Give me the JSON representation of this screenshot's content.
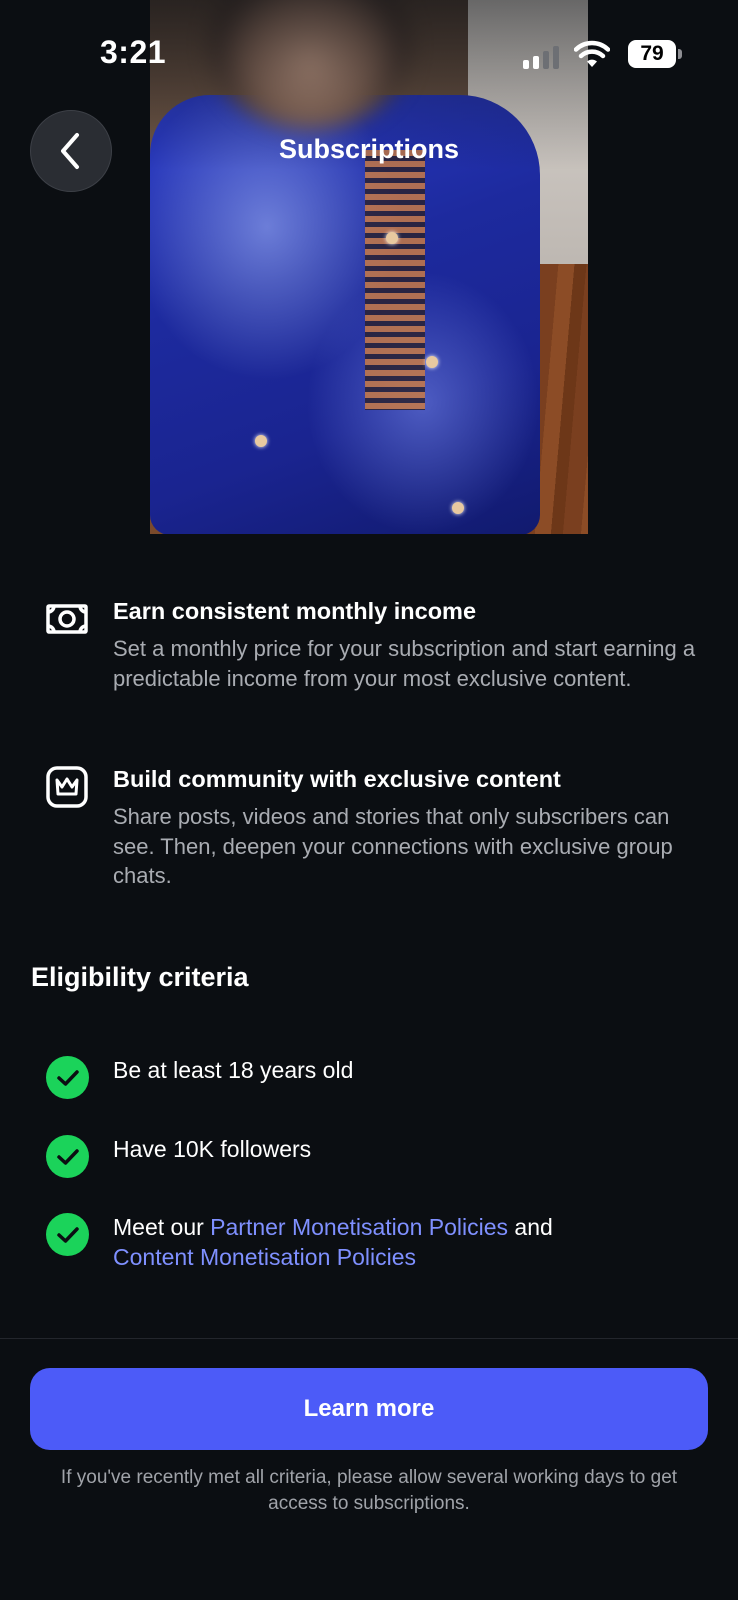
{
  "status_bar": {
    "time": "3:21",
    "battery": "79",
    "icons": [
      "cellular-signal-icon",
      "wifi-icon",
      "battery-icon"
    ]
  },
  "header": {
    "title": "Subscriptions",
    "back_icon": "chevron-left-icon"
  },
  "features": [
    {
      "icon": "money-icon",
      "title": "Earn consistent monthly income",
      "description": "Set a monthly price for your subscription and start earning a predictable income from your most exclusive content."
    },
    {
      "icon": "crown-badge-icon",
      "title": "Build community with exclusive content",
      "description": "Share posts, videos and stories that only subscribers can see. Then, deepen your connections with exclusive group chats."
    }
  ],
  "eligibility": {
    "title": "Eligibility criteria",
    "items": [
      {
        "text": "Be at least 18 years old"
      },
      {
        "text": "Have 10K followers"
      },
      {
        "prefix": "Meet our ",
        "link1": "Partner Monetisation Policies",
        "middle": " and ",
        "link2": "Content Monetisation Policies"
      }
    ]
  },
  "cta": {
    "label": "Learn more",
    "footnote": "If you've recently met all criteria, please allow several working days to get access to subscriptions."
  },
  "colors": {
    "background": "#0b0e12",
    "accent": "#4c5bf8",
    "link": "#7f90ff",
    "check": "#1bd35a"
  }
}
